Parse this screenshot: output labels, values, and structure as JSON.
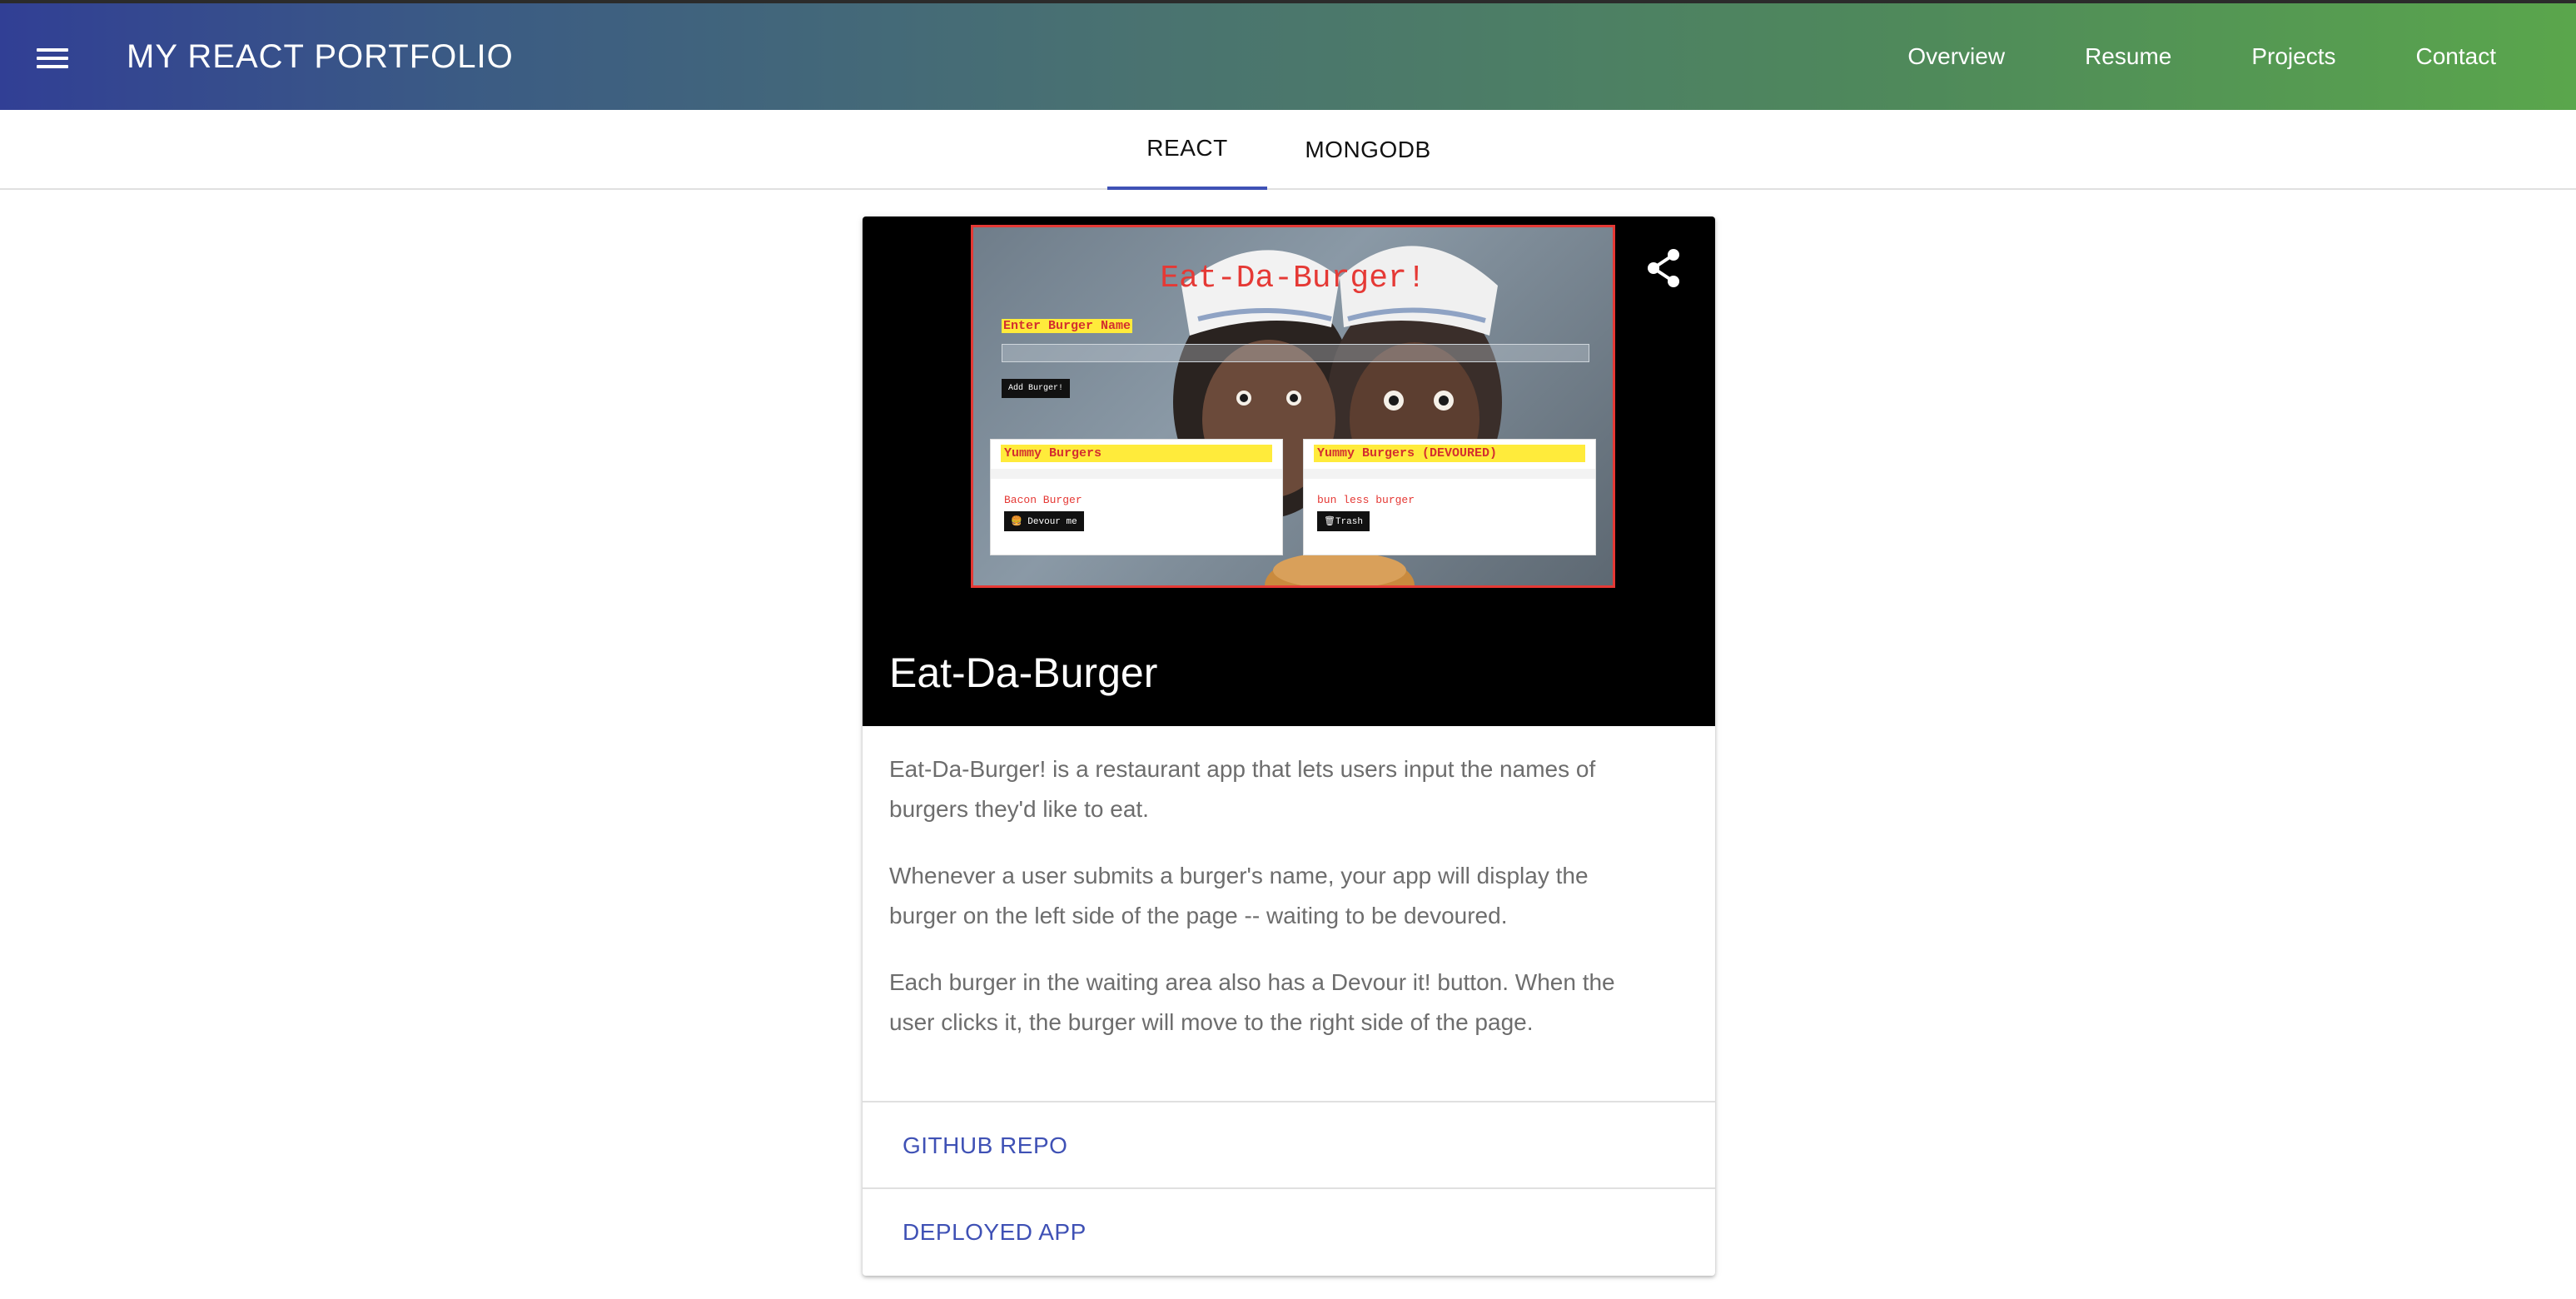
{
  "header": {
    "title": "MY REACT PORTFOLIO",
    "nav": [
      "Overview",
      "Resume",
      "Projects",
      "Contact"
    ]
  },
  "tabs": [
    {
      "label": "REACT",
      "active": true
    },
    {
      "label": "MONGODB",
      "active": false
    }
  ],
  "card": {
    "title": "Eat-Da-Burger",
    "paragraphs": [
      "Eat-Da-Burger! is a restaurant app that lets users input the names of burgers they'd like to eat.",
      "Whenever a user submits a burger's name, your app will display the burger on the left side of the page -- waiting to be devoured.",
      "Each burger in the waiting area also has a Devour it! button. When the user clicks it, the burger will move to the right side of the page."
    ],
    "actions": [
      "GITHUB REPO",
      "DEPLOYED APP"
    ],
    "preview": {
      "title": "Eat-Da-Burger!",
      "input_label": "Enter Burger Name",
      "add_button": "Add Burger!",
      "left_panel": {
        "heading": "Yummy Burgers",
        "item": "Bacon Burger",
        "button": "🍔 Devour me"
      },
      "right_panel": {
        "heading": "Yummy Burgers (DEVOURED)",
        "item": "bun less burger",
        "button": "🗑Trash"
      }
    }
  },
  "colors": {
    "accent": "#3f51b5",
    "header_start": "#313f95",
    "header_end": "#5aa64c",
    "preview_border": "#e53935",
    "preview_highlight": "#ffeb3b"
  },
  "icons": {
    "menu": "menu-icon",
    "share": "share-icon"
  }
}
